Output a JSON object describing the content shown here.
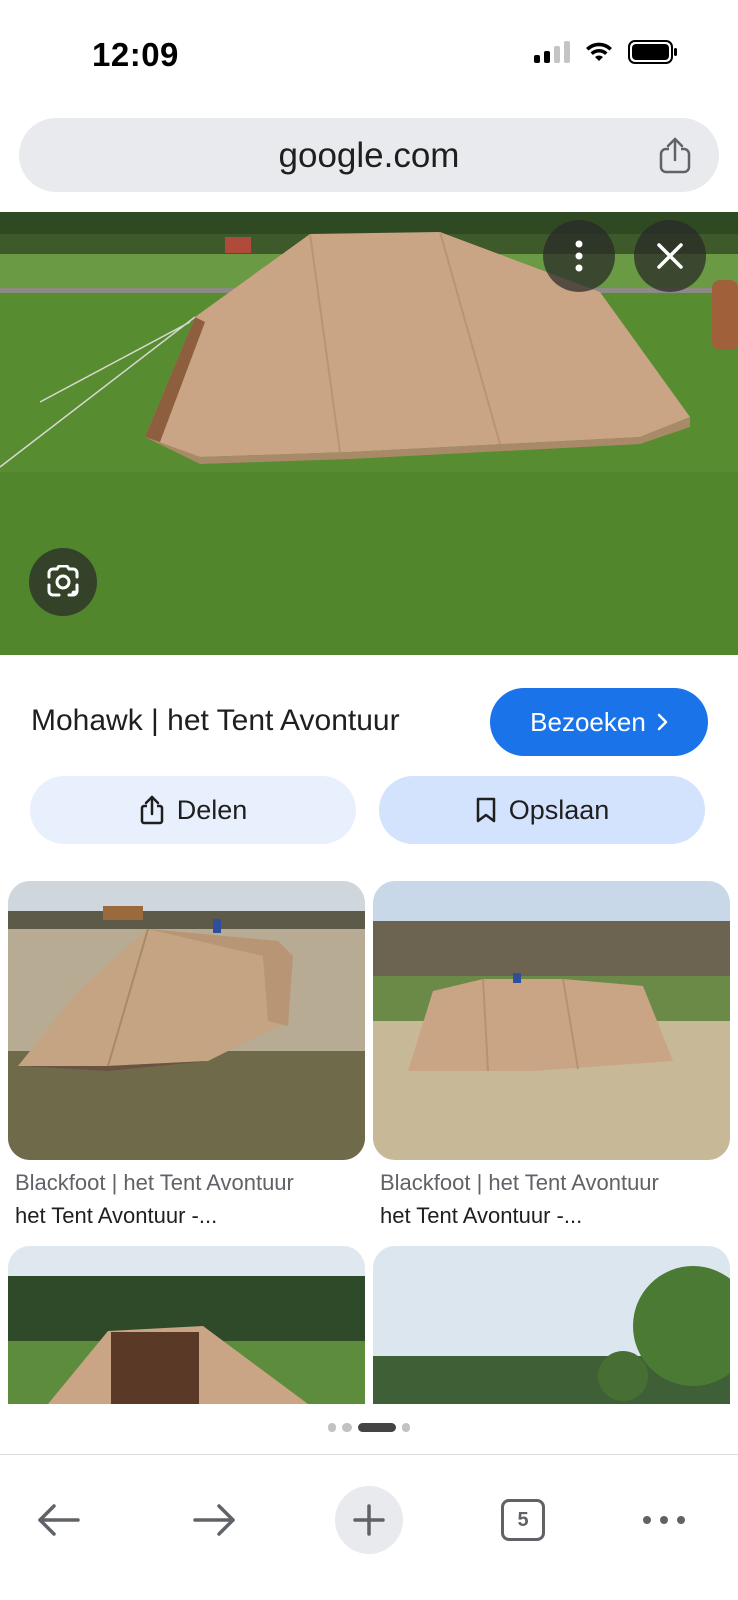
{
  "status_bar": {
    "time": "12:09",
    "icons": [
      "cellular-signal-icon",
      "wifi-icon",
      "battery-icon"
    ]
  },
  "url_bar": {
    "domain": "google.com",
    "share_icon": "share-icon"
  },
  "hero": {
    "overlay_icons": [
      "more-vertical-icon",
      "close-icon",
      "google-lens-icon"
    ]
  },
  "result": {
    "title": "Mohawk | het Tent Avontuur",
    "visit_label": "Bezoeken",
    "share_label": "Delen",
    "save_label": "Opslaan"
  },
  "related": [
    {
      "source": "Blackfoot | het Tent Avontuur",
      "description": "het Tent Avontuur -..."
    },
    {
      "source": "Blackfoot | het Tent Avontuur",
      "description": "het Tent Avontuur -..."
    },
    {
      "source": "",
      "description": ""
    },
    {
      "source": "",
      "description": ""
    }
  ],
  "bottom_bar": {
    "tab_count": "5",
    "icons": [
      "back-arrow-icon",
      "forward-arrow-icon",
      "plus-icon",
      "tabs-icon",
      "more-horizontal-icon"
    ]
  },
  "colors": {
    "accent": "#1a73e8",
    "chip_bg": "#e8f0fe",
    "url_bar_bg": "#e8eaed",
    "tent": "#c9a585",
    "grass": "#5b8a36"
  }
}
